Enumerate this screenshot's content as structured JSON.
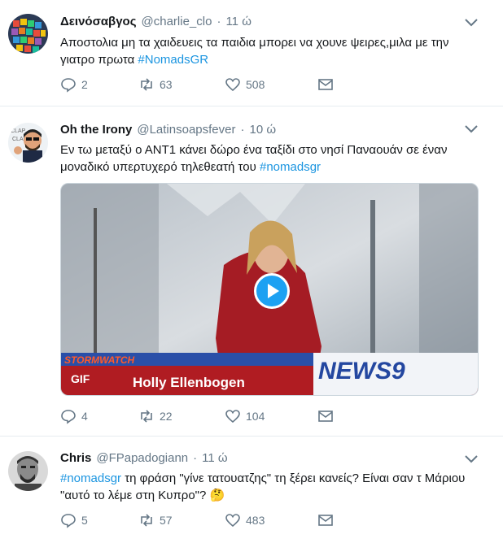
{
  "tweets": [
    {
      "name": "Δεινόσαβγος",
      "handle": "@charlie_clo",
      "dot": "·",
      "time": "11 ώ",
      "text_before": "Αποστολια μη τα χαιδευεις τα παιδια μπορει να χουνε ψειρες,μιλα με την γιατρο πρωτα ",
      "hashtag": "#NomadsGR",
      "text_after": "",
      "replies": "2",
      "retweets": "63",
      "likes": "508"
    },
    {
      "name": "Oh the Irony",
      "handle": "@Latinsoapsfever",
      "dot": "·",
      "time": "10 ώ",
      "text_before": "Εν τω μεταξύ ο ΑΝΤ1 κάνει δώρο ένα ταξίδι στο νησί Παναουάν σε έναν μοναδικό υπερτυχερό τηλεθεατή του ",
      "hashtag": "#nomadsgr",
      "text_after": "",
      "media": {
        "ticker_left": "STORMWATCH",
        "ticker_caption": "Holly Ellenbogen",
        "ticker_logo": "NEWS9",
        "gif_badge": "GIF"
      },
      "replies": "4",
      "retweets": "22",
      "likes": "104"
    },
    {
      "name": "Chris",
      "handle": "@FPapadogiann",
      "dot": "·",
      "time": "11 ώ",
      "text_before": "",
      "hashtag": "#nomadsgr",
      "text_after": " τη φράση \"γίνε τατουατζης\" τη ξέρει κανείς? Είναι σαν τ Μάριου \"αυτό το λέμε στη Κυπρο\"? 🤔",
      "replies": "5",
      "retweets": "57",
      "likes": "483"
    }
  ],
  "colors": {
    "link": "#1b95e0",
    "muted": "#657786",
    "divider": "#e6ecf0",
    "play": "#1da1f2"
  }
}
